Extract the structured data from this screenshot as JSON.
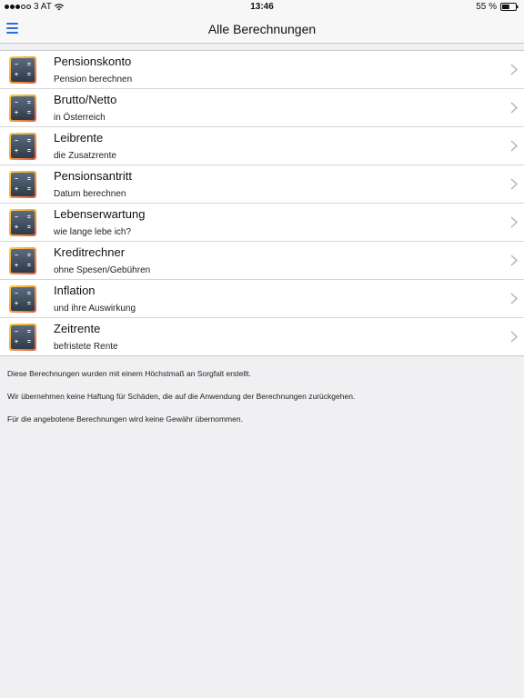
{
  "status_bar": {
    "signal_dots_filled": 3,
    "signal_dots_total": 5,
    "carrier": "3 AT",
    "wifi_icon": "wifi-icon",
    "time": "13:46",
    "battery_percent": "55 %",
    "battery_level": 0.55
  },
  "nav": {
    "menu_icon": "hamburger-menu-icon",
    "title": "Alle Berechnungen",
    "accent_color": "#2a6fd6"
  },
  "items": [
    {
      "title": "Pensionskonto",
      "subtitle": "Pension berechnen"
    },
    {
      "title": "Brutto/Netto",
      "subtitle": "in Österreich"
    },
    {
      "title": "Leibrente",
      "subtitle": "die Zusatzrente"
    },
    {
      "title": "Pensionsantritt",
      "subtitle": "Datum berechnen"
    },
    {
      "title": "Lebenserwartung",
      "subtitle": "wie lange lebe ich?"
    },
    {
      "title": "Kreditrechner",
      "subtitle": "ohne Spesen/Gebühren"
    },
    {
      "title": "Inflation",
      "subtitle": "und ihre Auswirkung"
    },
    {
      "title": "Zeitrente",
      "subtitle": "befristete Rente"
    }
  ],
  "item_icon": "calculator-icon",
  "item_chevron_icon": "chevron-right-icon",
  "calculator_glyphs": [
    "−",
    "=",
    "+",
    "="
  ],
  "notes": [
    "Diese Berechnungen wurden mit einem Höchstmaß an Sorgfalt erstellt.",
    "Wir übernehmen keine Haftung für Schäden, die auf die Anwendung der Berechnungen zurückgehen.",
    "Für die angebotene Berechnungen wird keine Gewähr übernommen."
  ]
}
